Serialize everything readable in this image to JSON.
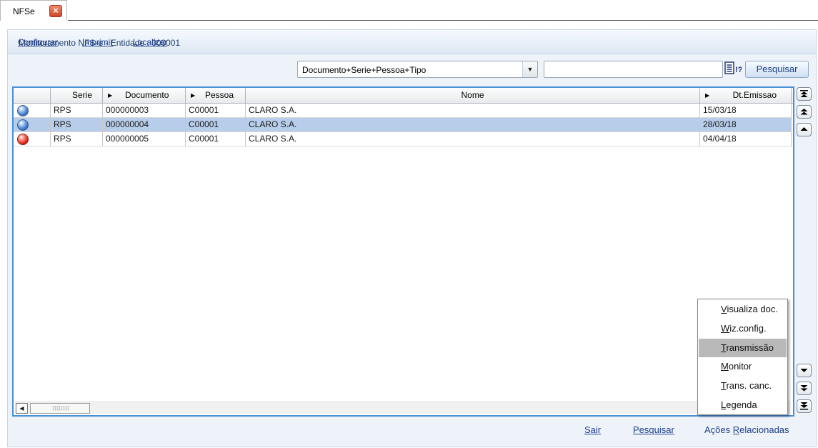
{
  "tab": {
    "label": "NFSe"
  },
  "header": {
    "title": "Monitoramento NFS-e - Entidade : 000001"
  },
  "toolbar": {
    "links": [
      "Configurar",
      "Imprimir",
      "Localizar"
    ],
    "order_select": "Documento+Serie+Pessoa+Tipo",
    "search_value": "",
    "search_button": "Pesquisar"
  },
  "grid": {
    "columns": [
      "",
      "Serie",
      "Documento",
      "Pessoa",
      "Nome",
      "Dt.Emissao"
    ],
    "rows": [
      {
        "status": "blue",
        "serie": "RPS",
        "documento": "000000003",
        "pessoa": "C00001",
        "nome": "CLARO S.A.",
        "dt_emissao": "15/03/18"
      },
      {
        "status": "blue",
        "serie": "RPS",
        "documento": "000000004",
        "pessoa": "C00001",
        "nome": "CLARO S.A.",
        "dt_emissao": "28/03/18",
        "selected": true
      },
      {
        "status": "red",
        "serie": "RPS",
        "documento": "000000005",
        "pessoa": "C00001",
        "nome": "CLARO S.A.",
        "dt_emissao": "04/04/18"
      }
    ]
  },
  "menu": {
    "items": [
      {
        "mnemonic": "V",
        "rest": "isualiza doc."
      },
      {
        "mnemonic": "W",
        "rest": "iz.config."
      },
      {
        "mnemonic": "T",
        "rest": "ransmissão",
        "highlighted": true
      },
      {
        "mnemonic": "M",
        "rest": "onitor"
      },
      {
        "mnemonic": "T",
        "rest": "rans. canc."
      },
      {
        "mnemonic": "L",
        "rest": "egenda"
      }
    ]
  },
  "footer": {
    "sair": "Sair",
    "pesquisar": "Pesquisar",
    "acoes_prefix": "Ações ",
    "acoes_mnemonic": "R",
    "acoes_rest": "elacionadas"
  },
  "colors": {
    "accent": "#4a90d9",
    "selected_row": "#b7cde9",
    "link": "#1f3f8a"
  }
}
